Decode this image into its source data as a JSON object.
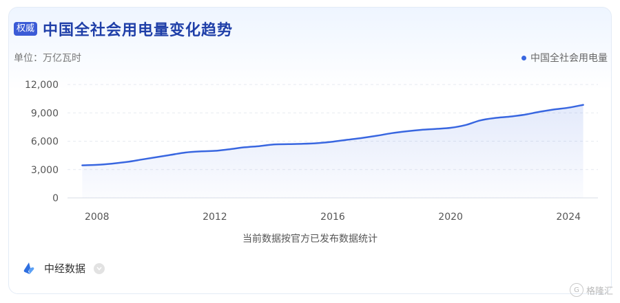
{
  "header": {
    "badge": "权威",
    "title": "中国全社会用电量变化趋势"
  },
  "unit_label": "单位：万亿瓦时",
  "footnote": "当前数据按官方已发布数据统计",
  "source": {
    "label": "中经数据"
  },
  "watermark": "格隆汇",
  "colors": {
    "line": "#3866e0",
    "badge": "#3b5bd6",
    "title": "#1f3fa8"
  },
  "chart_data": {
    "type": "area",
    "title": "中国全社会用电量变化趋势",
    "series": [
      {
        "name": "中国全社会用电量",
        "x": [
          2007.5,
          2008,
          2008.5,
          2009,
          2009.5,
          2010,
          2010.5,
          2011,
          2011.5,
          2012,
          2012.5,
          2013,
          2013.5,
          2014,
          2014.5,
          2015,
          2015.5,
          2016,
          2016.5,
          2017,
          2017.5,
          2018,
          2018.5,
          2019,
          2019.5,
          2020,
          2020.5,
          2021,
          2021.5,
          2022,
          2022.5,
          2023,
          2023.5,
          2024,
          2024.5
        ],
        "y": [
          3450,
          3500,
          3620,
          3800,
          4050,
          4300,
          4550,
          4800,
          4920,
          4980,
          5150,
          5350,
          5480,
          5650,
          5690,
          5720,
          5800,
          5950,
          6150,
          6350,
          6580,
          6850,
          7050,
          7200,
          7300,
          7420,
          7700,
          8200,
          8450,
          8600,
          8800,
          9100,
          9350,
          9550,
          9850
        ]
      }
    ],
    "xticks": [
      "2008",
      "2012",
      "2016",
      "2020",
      "2024"
    ],
    "yticks": [
      "0",
      "3,000",
      "6,000",
      "9,000",
      "12,000"
    ],
    "xlim": [
      2007,
      2025
    ],
    "ylim": [
      0,
      12000
    ],
    "grid": true,
    "legend": "top-right"
  }
}
